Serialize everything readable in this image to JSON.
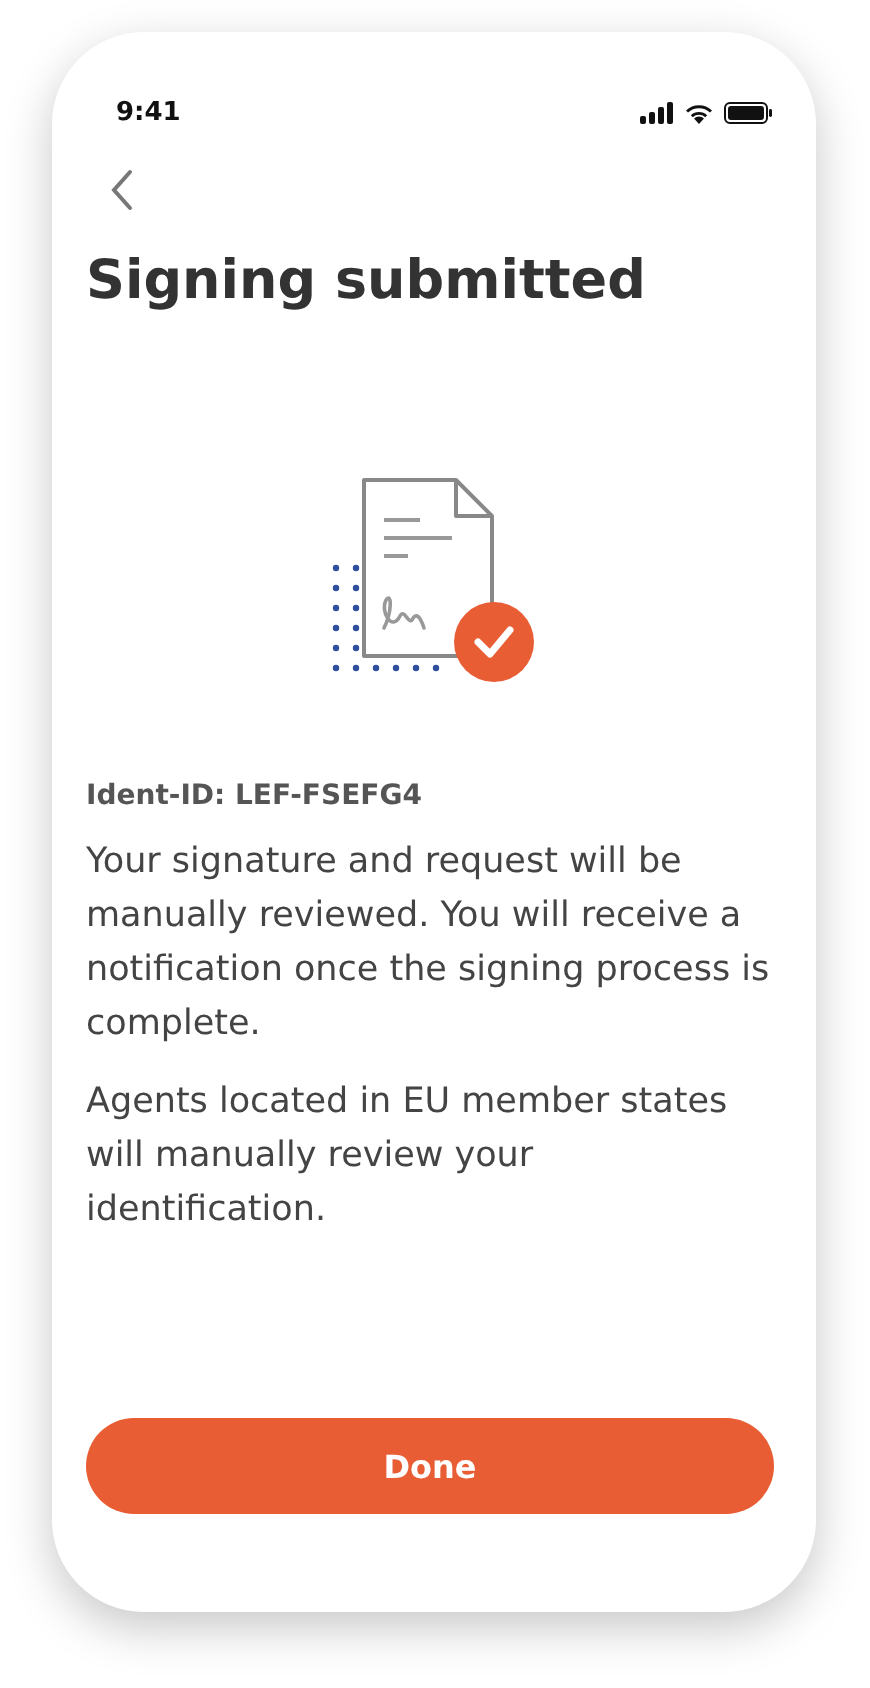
{
  "status_bar": {
    "time": "9:41"
  },
  "title": "Signing submitted",
  "ident": "Ident-ID: LEF-FSEFG4",
  "paragraphs": [
    "Your signature and request will be manually reviewed. You will receive a notification once the signing process is complete.",
    "Agents located in EU member states will manually review your identification."
  ],
  "button": {
    "label": "Done"
  }
}
